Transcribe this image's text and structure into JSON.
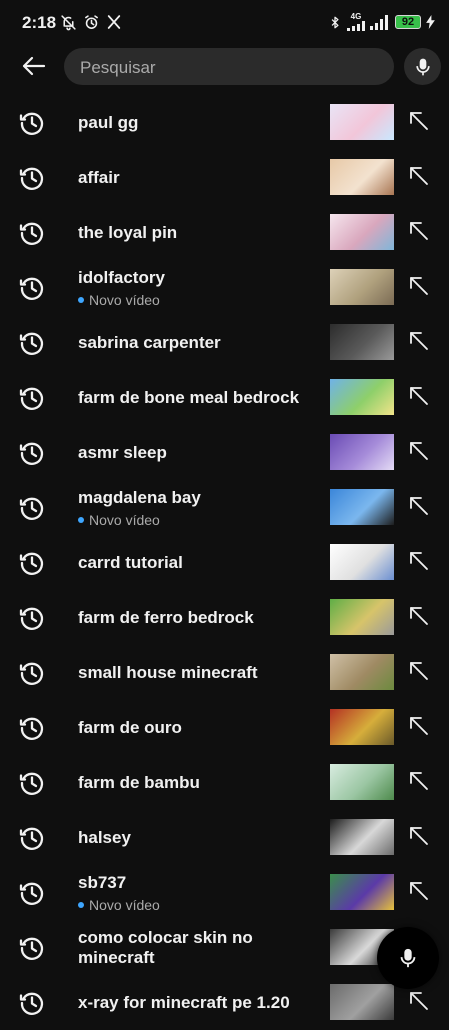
{
  "status_bar": {
    "time": "2:18",
    "left_icons": [
      "bell-off-icon",
      "alarm-icon",
      "x-icon"
    ],
    "right_icons": [
      "bluetooth-icon",
      "signal-4g-icon",
      "signal-icon",
      "battery-icon",
      "charging-icon"
    ],
    "network": "4G",
    "battery": "92"
  },
  "search": {
    "placeholder": "Pesquisar"
  },
  "history": [
    {
      "query": "paul gg",
      "thumb_colors": [
        "#e9e4f6",
        "#f2c6d9",
        "#c9e8ff"
      ]
    },
    {
      "query": "affair",
      "thumb_colors": [
        "#e7c9a7",
        "#f3e2cf",
        "#a87552"
      ]
    },
    {
      "query": "the loyal pin",
      "thumb_colors": [
        "#f6e6ee",
        "#d9a7bd",
        "#7fb6d9"
      ]
    },
    {
      "query": "idolfactory",
      "sub": "Novo vídeo",
      "thumb_colors": [
        "#ddd1b8",
        "#b0a17e",
        "#7b6b54"
      ]
    },
    {
      "query": "sabrina carpenter",
      "thumb_colors": [
        "#2c2c2c",
        "#5a5a5a",
        "#9a9a9a"
      ]
    },
    {
      "query": "farm de bone meal bedrock",
      "thumb_colors": [
        "#6fb2e8",
        "#8ecf6a",
        "#f2e48a"
      ]
    },
    {
      "query": "asmr sleep",
      "thumb_colors": [
        "#6a4bb4",
        "#a58bd9",
        "#e4dbf5"
      ]
    },
    {
      "query": "magdalena bay",
      "sub": "Novo vídeo",
      "thumb_colors": [
        "#3b86d9",
        "#7bb7ee",
        "#1d1d1d"
      ]
    },
    {
      "query": "carrd tutorial",
      "thumb_colors": [
        "#ffffff",
        "#e0e0e0",
        "#6b8fd1"
      ]
    },
    {
      "query": "farm de ferro bedrock",
      "thumb_colors": [
        "#5fae46",
        "#d7c46a",
        "#9a9a9a"
      ]
    },
    {
      "query": "small house minecraft",
      "thumb_colors": [
        "#cfc0a6",
        "#9f8a63",
        "#6c8a3e"
      ]
    },
    {
      "query": "farm de ouro",
      "thumb_colors": [
        "#b43123",
        "#d6ae3b",
        "#6b5a2a"
      ]
    },
    {
      "query": "farm de bambu",
      "thumb_colors": [
        "#d8ece0",
        "#9bc6a3",
        "#4e8a4c"
      ]
    },
    {
      "query": "halsey",
      "thumb_colors": [
        "#1c1c1c",
        "#d8d8d8",
        "#6b6b6b"
      ]
    },
    {
      "query": "sb737",
      "sub": "Novo vídeo",
      "thumb_colors": [
        "#3a8e4b",
        "#5b3aa8",
        "#e6c13b"
      ]
    },
    {
      "query": "como colocar skin no minecraft",
      "thumb_colors": [
        "#3a3a3a",
        "#d9d9d9",
        "#1a1a1a"
      ]
    },
    {
      "query": "x-ray for minecraft pe 1.20",
      "thumb_colors": [
        "#6b6b6b",
        "#a0a0a0",
        "#3a3a3a"
      ]
    }
  ]
}
